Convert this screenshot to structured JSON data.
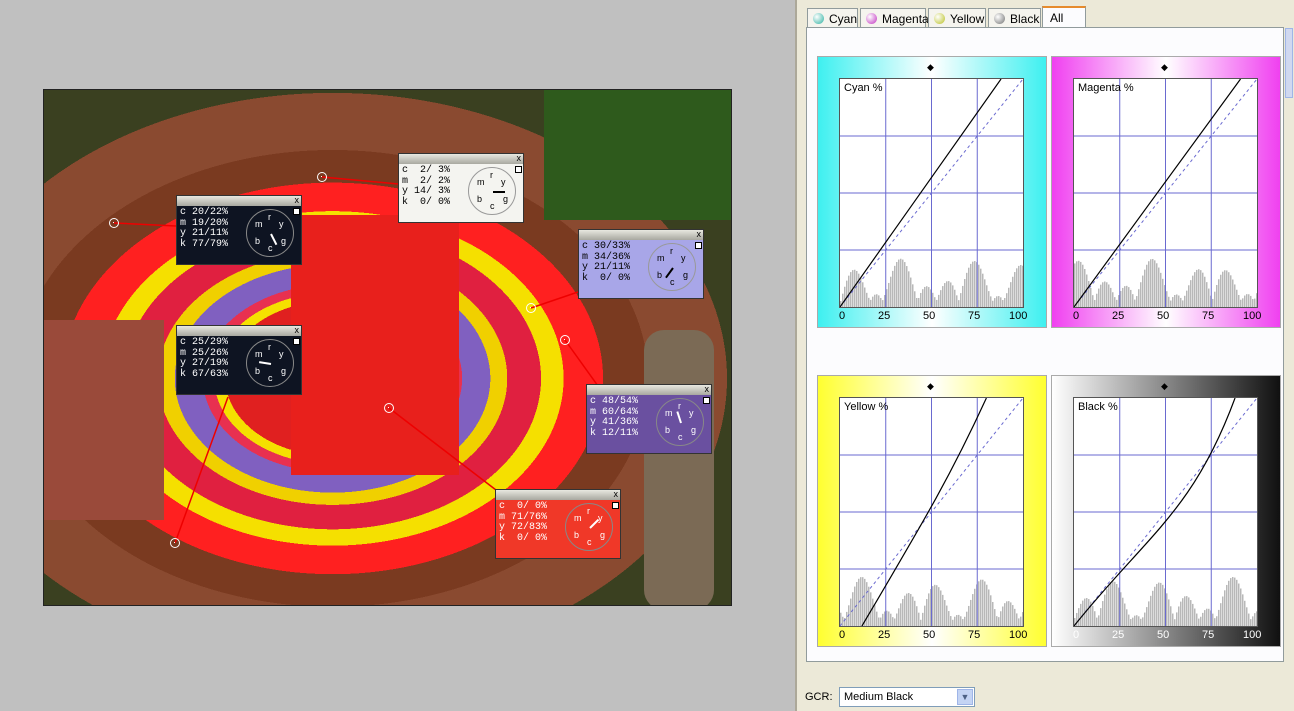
{
  "tabs": [
    {
      "label": "Cyan",
      "color": "#2ab0a0"
    },
    {
      "label": "Magenta",
      "color": "#c030c0"
    },
    {
      "label": "Yellow",
      "color": "#b8c020"
    },
    {
      "label": "Black",
      "color": "#707070"
    },
    {
      "label": "All",
      "color": ""
    }
  ],
  "active_tab": "All",
  "info_windows": [
    {
      "id": "w1",
      "close": "x",
      "rows": [
        "c  2/ 3%",
        "m  2/ 2%",
        "y 14/ 3%",
        "k  0/ 0%"
      ],
      "bg": "#f4f4f0",
      "fg": "#000",
      "dial_letters": [
        "m",
        "r",
        "y",
        "b",
        "c",
        "g"
      ]
    },
    {
      "id": "w2",
      "close": "x",
      "rows": [
        "c 20/22%",
        "m 19/20%",
        "y 21/11%",
        "k 77/79%"
      ],
      "bg": "#0e1422",
      "fg": "#fff",
      "dial_letters": [
        "m",
        "r",
        "y",
        "b",
        "c",
        "g"
      ]
    },
    {
      "id": "w3",
      "close": "x",
      "rows": [
        "c 30/33%",
        "m 34/36%",
        "y 21/11%",
        "k  0/ 0%"
      ],
      "bg": "#a8a6e8",
      "fg": "#000",
      "dial_letters": [
        "m",
        "r",
        "y",
        "b",
        "c",
        "g"
      ]
    },
    {
      "id": "w4",
      "close": "x",
      "rows": [
        "c 25/29%",
        "m 25/26%",
        "y 27/19%",
        "k 67/63%"
      ],
      "bg": "#0e1422",
      "fg": "#fff",
      "dial_letters": [
        "m",
        "r",
        "y",
        "b",
        "c",
        "g"
      ]
    },
    {
      "id": "w5",
      "close": "x",
      "rows": [
        "c 48/54%",
        "m 60/64%",
        "y 41/36%",
        "k 12/11%"
      ],
      "bg": "#6a50a0",
      "fg": "#fff",
      "dial_letters": [
        "m",
        "r",
        "y",
        "b",
        "c",
        "g"
      ]
    },
    {
      "id": "w6",
      "close": "x",
      "rows": [
        "c  0/ 0%",
        "m 71/76%",
        "y 72/83%",
        "k  0/ 0%"
      ],
      "bg": "#f03828",
      "fg": "#fff",
      "dial_letters": [
        "m",
        "r",
        "y",
        "b",
        "c",
        "g"
      ]
    }
  ],
  "graphs": [
    {
      "id": "cyan",
      "title": "Cyan %",
      "grad": "#3ef0f0",
      "line": "#000"
    },
    {
      "id": "magenta",
      "title": "Magenta %",
      "grad": "#f040f0",
      "line": "#000"
    },
    {
      "id": "yellow",
      "title": "Yellow %",
      "grad": "#ffff30",
      "line": "#000"
    },
    {
      "id": "black",
      "title": "Black %",
      "grad": "#101010",
      "line": "#000"
    }
  ],
  "axis_ticks": [
    "0",
    "25",
    "50",
    "75",
    "100"
  ],
  "gcr": {
    "label": "GCR:",
    "value": "Medium Black"
  }
}
